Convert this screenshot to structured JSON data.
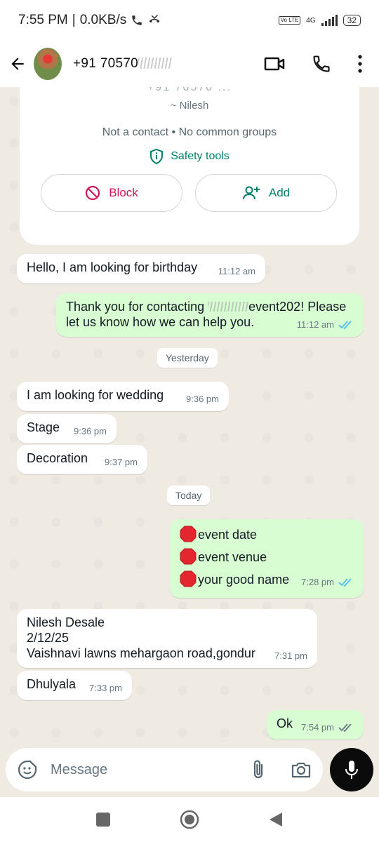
{
  "status": {
    "time": "7:55 PM",
    "net_speed": "0.0KB/s",
    "volte": "Vo LTE",
    "network": "4G",
    "battery": "32"
  },
  "header": {
    "title": "+91 70570",
    "title_obscured": true
  },
  "info_card": {
    "top_faded": "+91 70570 ...",
    "nickname": "~ Nilesh",
    "meta": "Not a contact • No common groups",
    "safety_label": "Safety tools",
    "block_label": "Block",
    "add_label": "Add"
  },
  "messages": [
    {
      "dir": "in",
      "text": "Hello, I am looking for birthday",
      "time": "11:12 am"
    },
    {
      "dir": "out",
      "text_before": "Thank you for contacting ",
      "text_after": "event202! Please",
      "line2": "let us know how we can help you.",
      "time": "11:12 am"
    },
    {
      "dir": "in",
      "text": "I am looking  for wedding",
      "time": "9:36 pm"
    },
    {
      "dir": "in",
      "text": "Stage",
      "time": "9:36 pm"
    },
    {
      "dir": "in",
      "text": "Decoration",
      "time": "9:37 pm"
    },
    {
      "dir": "out",
      "lines": [
        "event date",
        "event venue",
        "your good name"
      ],
      "time": "7:28 pm"
    },
    {
      "dir": "in",
      "lines": [
        "Nilesh Desale",
        "2/12/25",
        "Vaishnavi lawns mehargaon road,gondur"
      ],
      "time": "7:31 pm"
    },
    {
      "dir": "in",
      "text": "Dhulyala",
      "time": "7:33 pm"
    },
    {
      "dir": "out",
      "text": "Ok",
      "time": "7:54 pm"
    }
  ],
  "date_chips": {
    "yesterday": "Yesterday",
    "today": "Today"
  },
  "input": {
    "placeholder": "Message"
  },
  "colors": {
    "accent": "#008069",
    "block_red": "#d4145a",
    "out_bubble": "#d9fdd3",
    "tick_blue": "#53bdeb"
  }
}
